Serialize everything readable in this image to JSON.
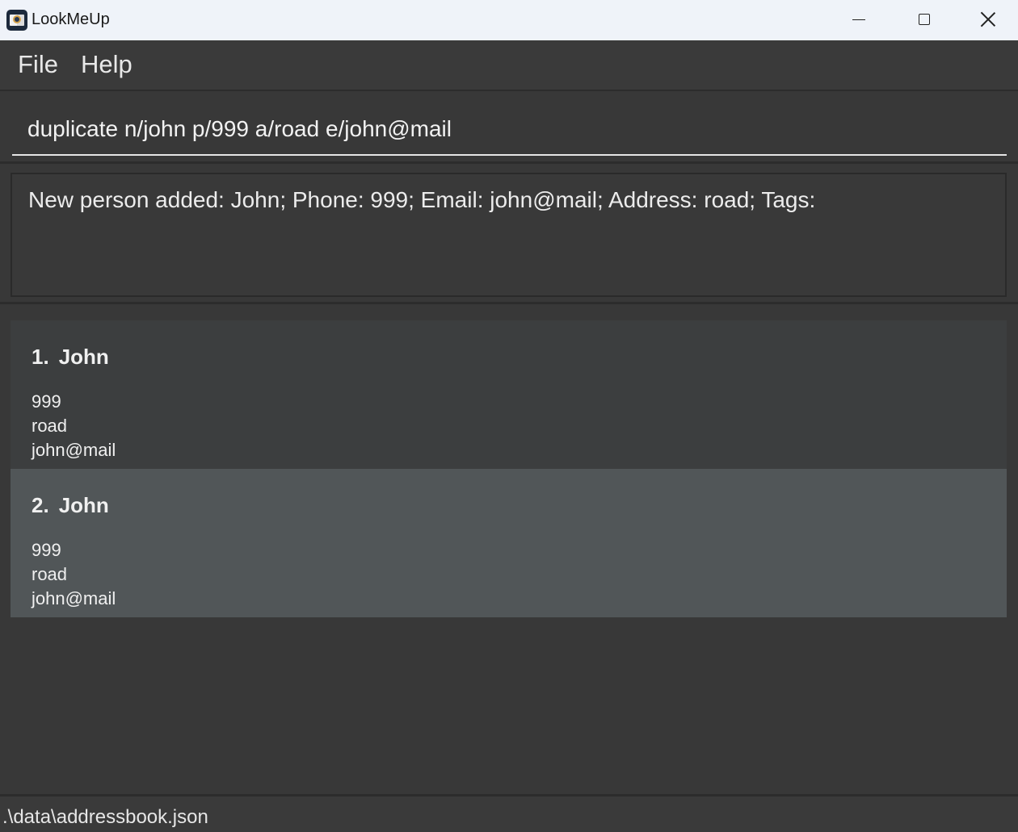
{
  "window": {
    "title": "LookMeUp",
    "icon": "book-magnifier-app-icon",
    "controls": [
      "minimize-icon",
      "maximize-icon",
      "close-icon"
    ]
  },
  "menu": {
    "file_label": "File",
    "help_label": "Help"
  },
  "command_box": {
    "value": "duplicate n/john p/999 a/road e/john@mail"
  },
  "result_display": {
    "text": "New person added: John; Phone: 999; Email: john@mail; Address: road; Tags:"
  },
  "persons": [
    {
      "index": "1.",
      "name": "John",
      "phone": "999",
      "address": "road",
      "email": "john@mail",
      "selected": false
    },
    {
      "index": "2.",
      "name": "John",
      "phone": "999",
      "address": "road",
      "email": "john@mail",
      "selected": true
    }
  ],
  "status_bar": {
    "file_path": ".\\data\\addressbook.json"
  },
  "colors": {
    "background": "#383838",
    "titlebar": "#eff3f9",
    "card": "#3c3e3f",
    "card_selected": "#515658",
    "text": "#f0f0f0"
  }
}
